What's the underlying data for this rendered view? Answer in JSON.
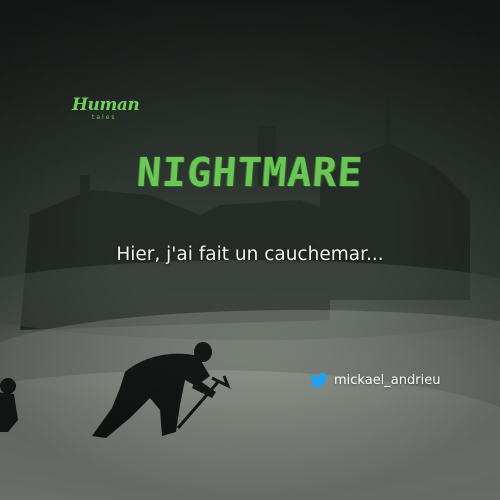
{
  "brand": {
    "name": "Human",
    "sub": "tales"
  },
  "title": "NIGHTMARE",
  "subtitle": "Hier, j'ai fait un cauchemar...",
  "social": {
    "icon": "twitter-bird-icon",
    "handle": "mickael_andrieu"
  },
  "colors": {
    "accent": "#6cc557",
    "text": "#f2f2ee",
    "twitter": "#1da1f2"
  }
}
